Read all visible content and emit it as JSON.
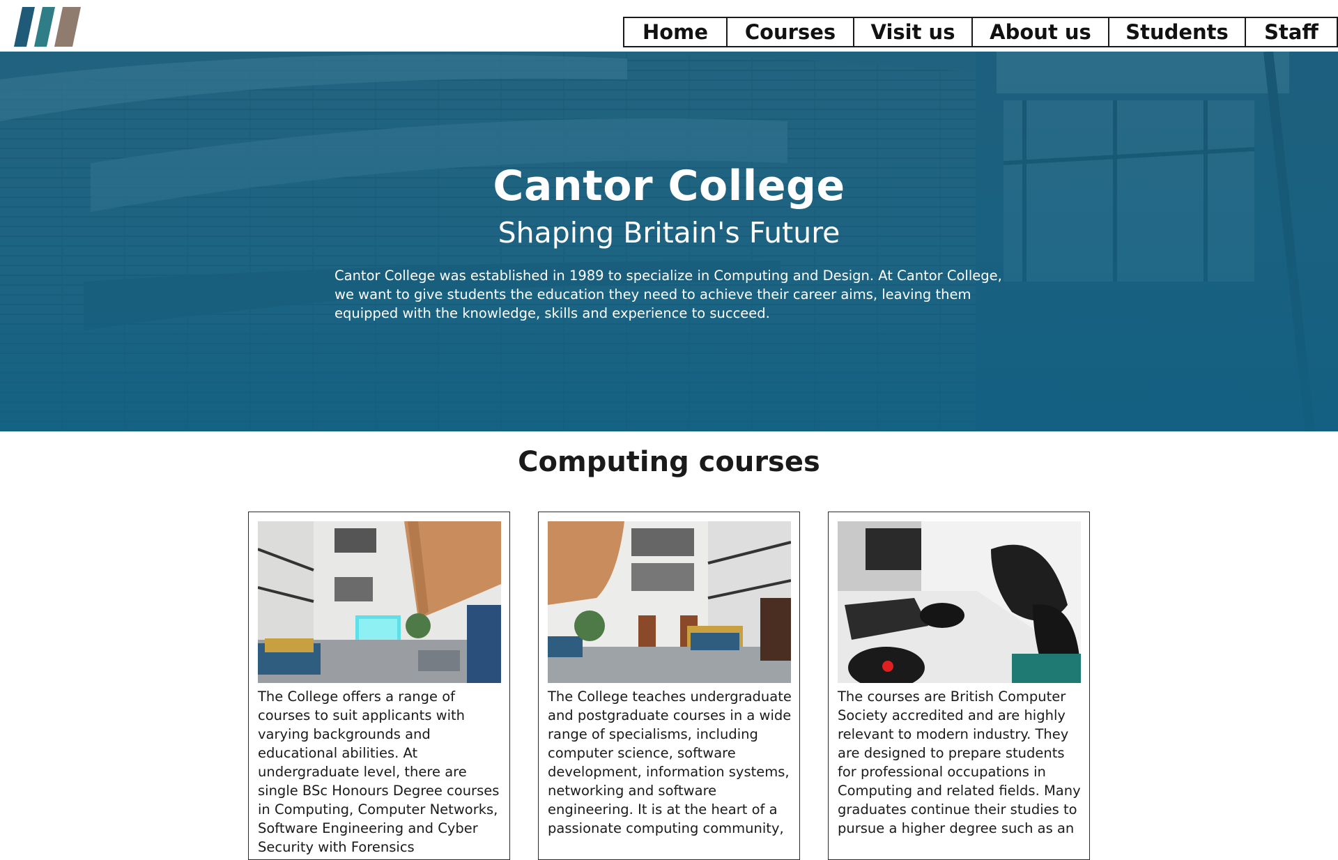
{
  "header": {
    "logo": {
      "icon": "three-slash-logo",
      "colors": [
        "#1f5a78",
        "#2f7d86",
        "#8f7c6e"
      ]
    },
    "nav": [
      {
        "label": "Home"
      },
      {
        "label": "Courses"
      },
      {
        "label": "Visit us"
      },
      {
        "label": "About us"
      },
      {
        "label": "Students"
      },
      {
        "label": "Staff"
      }
    ]
  },
  "hero": {
    "title": "Cantor College",
    "subtitle": "Shaping Britain's Future",
    "text": "Cantor College was established in 1989 to specialize in Computing and Design. At Cantor College, we want to give students the education they need to achieve their career aims, leaving them equipped with the knowledge, skills and experience to succeed.",
    "overlay_color": "#15607f"
  },
  "courses": {
    "title": "Computing courses",
    "cards": [
      {
        "image": "atrium-with-screen-photo",
        "text": "The College offers a range of courses to suit applicants with varying backgrounds and educational abilities. At undergraduate level, there are single BSc Honours Degree courses in Computing, Computer Networks, Software Engineering and Cyber Security with Forensics"
      },
      {
        "image": "atrium-hall-photo",
        "text": "The College teaches undergraduate and postgraduate courses in a wide range of specialisms, including computer science, software development, information systems, networking and software engineering. It is at the heart of a passionate computing community,"
      },
      {
        "image": "gaming-desk-photo",
        "text": "The courses are British Computer Society accredited and are highly relevant to modern industry. They are designed to prepare students for professional occupations in Computing and related fields. Many graduates continue their studies to pursue a higher degree such as an"
      }
    ]
  }
}
